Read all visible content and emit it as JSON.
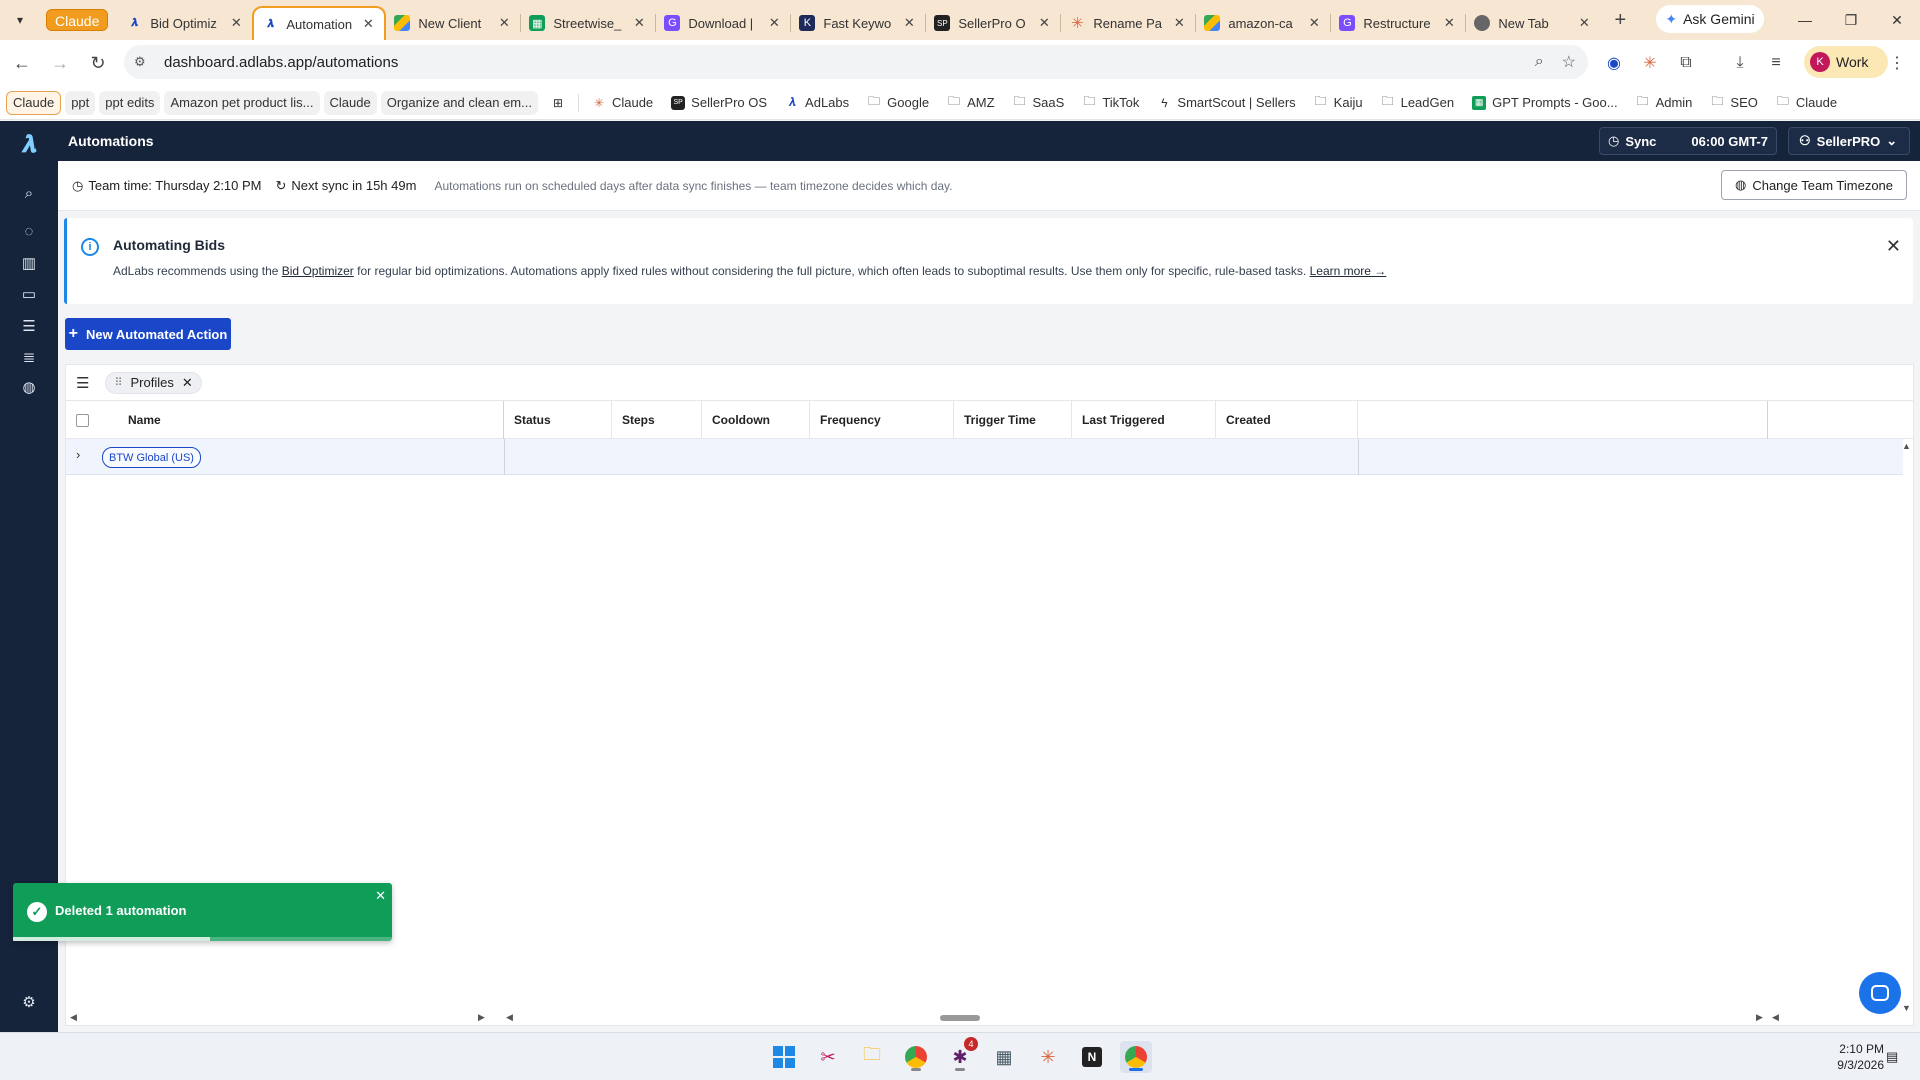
{
  "browser": {
    "group_label": "Claude",
    "tabs": [
      {
        "title": "Bid Optimiz",
        "icon": "adlabs-icon",
        "active": false
      },
      {
        "title": "Automation",
        "icon": "adlabs-icon",
        "active": true
      },
      {
        "title": "New Client",
        "icon": "drive-icon",
        "active": false
      },
      {
        "title": "Streetwise_",
        "icon": "sheets-icon",
        "active": false
      },
      {
        "title": "Download |",
        "icon": "g-icon",
        "active": false
      },
      {
        "title": "Fast Keywo",
        "icon": "k-icon",
        "active": false
      },
      {
        "title": "SellerPro O",
        "icon": "sp-icon",
        "active": false
      },
      {
        "title": "Rename Pa",
        "icon": "claude-icon",
        "active": false
      },
      {
        "title": "amazon-ca",
        "icon": "drive-icon",
        "active": false
      },
      {
        "title": "Restructure",
        "icon": "g-icon",
        "active": false
      },
      {
        "title": "New Tab",
        "icon": "chrome-icon",
        "active": false
      }
    ],
    "gemini_label": "Ask Gemini",
    "url": "dashboard.adlabs.app/automations",
    "profile_initial": "K",
    "profile_label": "Work",
    "bookmarks": [
      {
        "label": "Claude",
        "style": "chip"
      },
      {
        "label": "ppt",
        "style": "grey"
      },
      {
        "label": "ppt edits",
        "style": "grey"
      },
      {
        "label": "Amazon pet product lis...",
        "style": "grey"
      },
      {
        "label": "Claude",
        "style": "grey"
      },
      {
        "label": "Organize and clean em...",
        "style": "grey"
      },
      {
        "label": "Claude",
        "icon": "claude-icon"
      },
      {
        "label": "SellerPro OS",
        "icon": "sp-icon"
      },
      {
        "label": "AdLabs",
        "icon": "adlabs-icon"
      },
      {
        "label": "Google",
        "icon": "folder-icon"
      },
      {
        "label": "AMZ",
        "icon": "folder-icon"
      },
      {
        "label": "SaaS",
        "icon": "folder-icon"
      },
      {
        "label": "TikTok",
        "icon": "folder-icon"
      },
      {
        "label": "SmartScout | Sellers",
        "icon": "smartscout-icon"
      },
      {
        "label": "Kaiju",
        "icon": "folder-icon"
      },
      {
        "label": "LeadGen",
        "icon": "folder-icon"
      },
      {
        "label": "GPT Prompts - Goo...",
        "icon": "sheets-icon"
      },
      {
        "label": "Admin",
        "icon": "folder-icon"
      },
      {
        "label": "SEO",
        "icon": "folder-icon"
      },
      {
        "label": "Claude",
        "icon": "folder-icon"
      }
    ]
  },
  "app": {
    "page_title": "Automations",
    "sync_label": "Sync",
    "sync_time": "06:00 GMT-7",
    "account_label": "SellerPRO",
    "team_time": "Team time: Thursday 2:10 PM",
    "next_sync": "Next sync in 15h 49m",
    "schedule_note": "Automations run on scheduled days after data sync finishes — team timezone decides which day.",
    "change_tz_label": "Change Team Timezone",
    "alert": {
      "title": "Automating Bids",
      "body_pre": "AdLabs recommends using the ",
      "body_link": "Bid Optimizer",
      "body_post": " for regular bid optimizations. Automations apply fixed rules without considering the full picture, which often leads to suboptimal results. Use them only for specific, rule-based tasks. ",
      "learn_more": "Learn more →"
    },
    "new_action_label": "New Automated Action",
    "group_by_label": "Profiles",
    "columns": [
      "Name",
      "Status",
      "Steps",
      "Cooldown",
      "Frequency",
      "Trigger Time",
      "Last Triggered",
      "Created"
    ],
    "rows": [
      {
        "profile": "BTW Global (US)"
      }
    ],
    "toast": {
      "message": "Deleted 1 automation",
      "progress": 0.52
    }
  },
  "taskbar": {
    "apps": [
      "windows-start-icon",
      "snipping-tool-icon",
      "file-explorer-icon",
      "chrome-icon",
      "slack-icon",
      "calculator-icon",
      "claude-icon",
      "notion-icon",
      "chrome-work-icon"
    ],
    "slack_badge": "4",
    "time": "2:10 PM",
    "date": "9/3/2026"
  },
  "colors": {
    "brand_navy": "#15233b",
    "primary_blue": "#1a47c7",
    "toast_green": "#0f9d58",
    "tab_accent": "#f29c1f"
  }
}
